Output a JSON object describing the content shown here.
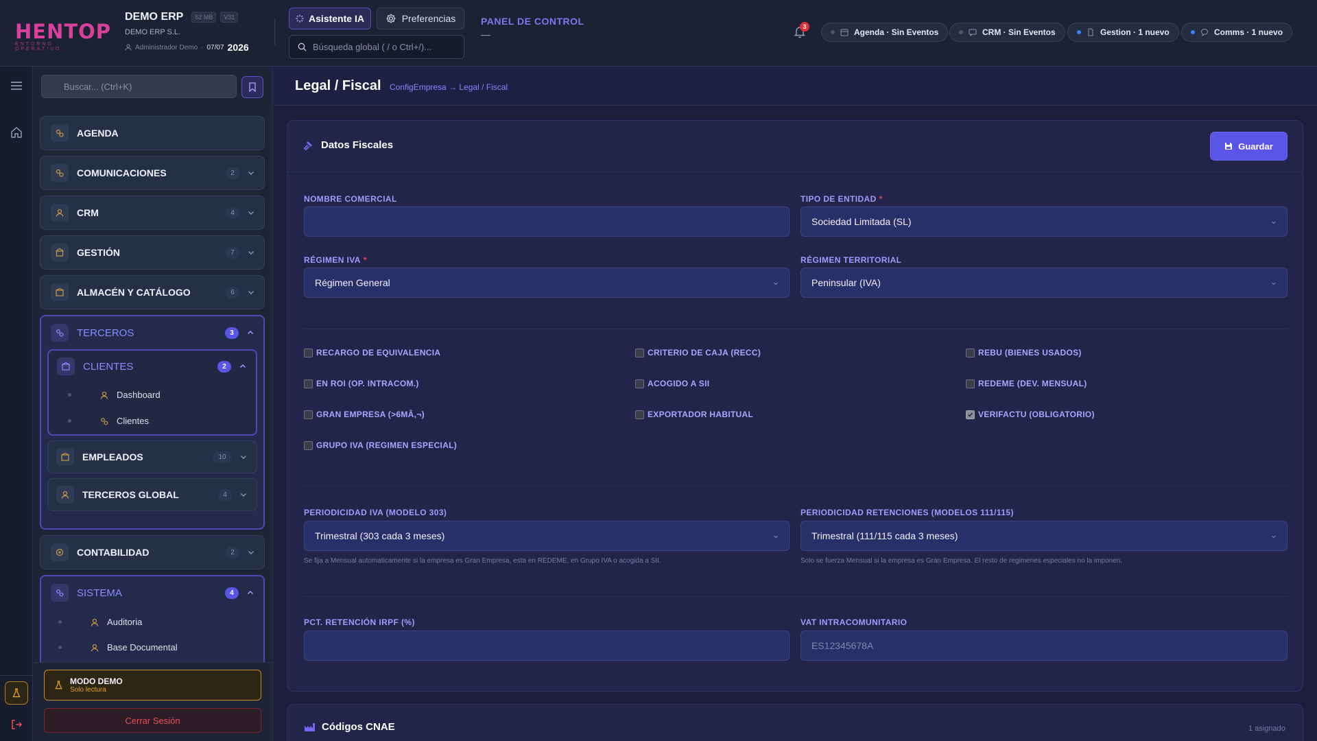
{
  "brand": {
    "logo_text": "HENTOP",
    "logo_sub": "ENTORNO OPERATIVO"
  },
  "header": {
    "app_name": "DEMO ERP",
    "memory_badge": "62 MB",
    "version_badge": "V31",
    "company": "DEMO ERP S.L.",
    "user": "Administrador Demo",
    "date": "07/07",
    "year": "2026",
    "ai_button": "Asistente IA",
    "prefs_button": "Preferencias",
    "search_placeholder": "Búsqueda global ( / o Ctrl+/)...",
    "panel_title": "PANEL DE CONTROL",
    "panel_sub": "—",
    "notifications_count": "3",
    "chips": [
      {
        "label": "Agenda · Sin Eventos",
        "icon": "calendar-icon",
        "dot": "grey"
      },
      {
        "label": "CRM · Sin Eventos",
        "icon": "chat-icon",
        "dot": "grey"
      },
      {
        "label": "Gestion · 1 nuevo",
        "icon": "document-icon",
        "dot": "blue"
      },
      {
        "label": "Comms · 1 nuevo",
        "icon": "bubble-icon",
        "dot": "blue"
      }
    ]
  },
  "sidebar": {
    "search_placeholder": "Buscar... (Ctrl+K)",
    "items": [
      {
        "label": "AGENDA",
        "count": ""
      },
      {
        "label": "COMUNICACIONES",
        "count": "2"
      },
      {
        "label": "CRM",
        "count": "4"
      },
      {
        "label": "GESTIÓN",
        "count": "7"
      },
      {
        "label": "ALMACÉN Y CATÁLOGO",
        "count": "6"
      }
    ],
    "terceros": {
      "label": "TERCEROS",
      "count": "3",
      "clientes": {
        "label": "CLIENTES",
        "count": "2",
        "leaves": [
          "Dashboard",
          "Clientes"
        ]
      },
      "empleados": {
        "label": "EMPLEADOS",
        "count": "10"
      },
      "global": {
        "label": "TERCEROS GLOBAL",
        "count": "4"
      }
    },
    "contabilidad": {
      "label": "CONTABILIDAD",
      "count": "2"
    },
    "sistema": {
      "label": "SISTEMA",
      "count": "4",
      "leaves": [
        "Auditoria",
        "Base Documental"
      ]
    },
    "demo_title": "MODO DEMO",
    "demo_sub": "Solo lectura",
    "logout": "Cerrar Sesión"
  },
  "page": {
    "title": "Legal / Fiscal",
    "breadcrumb": "ConfigEmpresa → Legal / Fiscal"
  },
  "fiscal": {
    "title": "Datos Fiscales",
    "save": "Guardar",
    "nombre_comercial": {
      "label": "NOMBRE COMERCIAL",
      "value": ""
    },
    "tipo_entidad": {
      "label": "TIPO DE ENTIDAD",
      "value": "Sociedad Limitada (SL)"
    },
    "regimen_iva": {
      "label": "RÉGIMEN IVA",
      "value": "Régimen General"
    },
    "regimen_territorial": {
      "label": "RÉGIMEN TERRITORIAL",
      "value": "Peninsular (IVA)"
    },
    "checkboxes": [
      {
        "label": "RECARGO DE EQUIVALENCIA",
        "checked": false
      },
      {
        "label": "CRITERIO DE CAJA (RECC)",
        "checked": false
      },
      {
        "label": "REBU (BIENES USADOS)",
        "checked": false
      },
      {
        "label": "EN ROI (OP. INTRACOM.)",
        "checked": false
      },
      {
        "label": "ACOGIDO A SII",
        "checked": false
      },
      {
        "label": "REDEME (DEV. MENSUAL)",
        "checked": false
      },
      {
        "label": "GRAN EMPRESA (>6MÂ,¬)",
        "checked": false
      },
      {
        "label": "EXPORTADOR HABITUAL",
        "checked": false
      },
      {
        "label": "VERIFACTU (OBLIGATORIO)",
        "checked": true
      },
      {
        "label": "GRUPO IVA (REGIMEN ESPECIAL)",
        "checked": false
      }
    ],
    "periodicidad_iva": {
      "label": "PERIODICIDAD IVA (MODELO 303)",
      "value": "Trimestral (303 cada 3 meses)",
      "hint": "Se fija a Mensual automaticamente si la empresa es Gran Empresa, esta en REDEME, en Grupo IVA o acogida a SII."
    },
    "periodicidad_ret": {
      "label": "PERIODICIDAD RETENCIONES (MODELOS 111/115)",
      "value": "Trimestral (111/115 cada 3 meses)",
      "hint": "Solo se fuerza Mensual si la empresa es Gran Empresa. El resto de regimenes especiales no la imponen."
    },
    "pct_irpf": {
      "label": "PCT. RETENCIÓN IRPF (%)",
      "value": ""
    },
    "vat": {
      "label": "VAT INTRACOMUNITARIO",
      "placeholder": "ES12345678A"
    }
  },
  "cnae": {
    "title": "Códigos CNAE",
    "meta": "1 asignado"
  },
  "colors": {
    "accent": "#5a55e6",
    "brand": "#d8409a",
    "warning": "#e8a423",
    "danger": "#ef4b5a"
  }
}
